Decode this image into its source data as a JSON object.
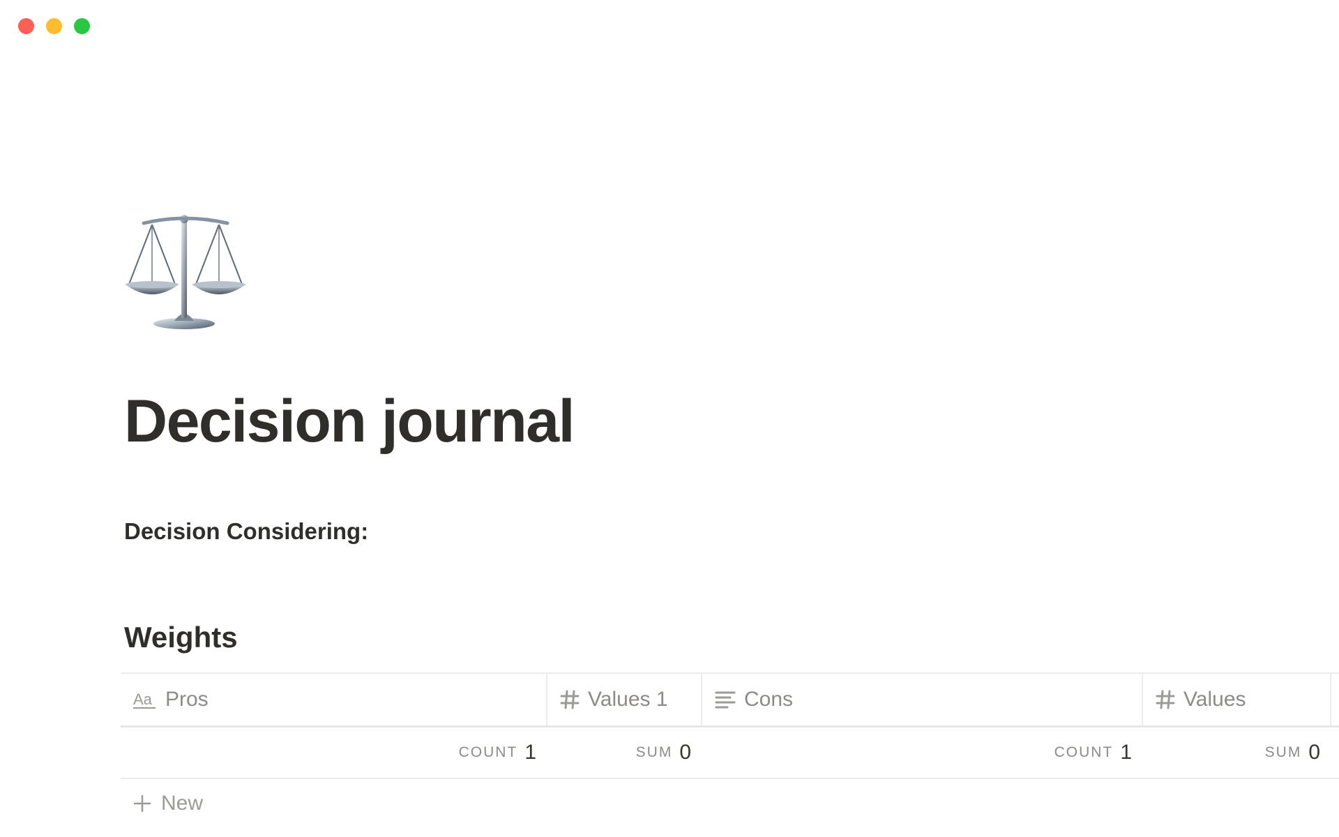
{
  "window": {
    "controls": [
      "close",
      "minimize",
      "zoom"
    ]
  },
  "page": {
    "icon": "balance-scale-icon",
    "title": "Decision journal",
    "subheading": "Decision Considering:",
    "section_heading": "Weights"
  },
  "table": {
    "columns": [
      {
        "label": "Pros",
        "icon": "text-aa-icon",
        "calc_label": "COUNT",
        "calc_value": "1"
      },
      {
        "label": "Values 1",
        "icon": "number-hash-icon",
        "calc_label": "SUM",
        "calc_value": "0"
      },
      {
        "label": "Cons",
        "icon": "lines-text-icon",
        "calc_label": "COUNT",
        "calc_value": "1"
      },
      {
        "label": "Values",
        "icon": "number-hash-icon",
        "calc_label": "SUM",
        "calc_value": "0"
      }
    ],
    "new_label": "New"
  },
  "colors": {
    "close": "#fe5f57",
    "minimize": "#febc2e",
    "zoom": "#28c840",
    "text": "#37352f",
    "muted": "#8c8b87"
  }
}
